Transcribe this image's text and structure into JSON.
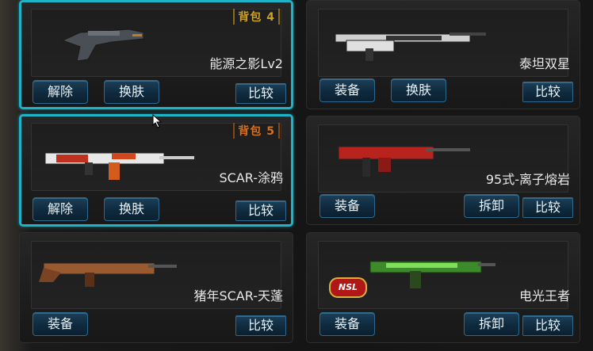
{
  "cards": [
    {
      "name": "能源之影Lv2",
      "bag": "背包 4",
      "selected": true,
      "buttons": [
        "解除",
        "换肤"
      ],
      "compare": "比较"
    },
    {
      "name": "泰坦双星",
      "selected": false,
      "buttons": [
        "装备",
        "换肤"
      ],
      "compare": "比较"
    },
    {
      "name": "SCAR-涂鸦",
      "bag": "背包 5",
      "selected": true,
      "buttons": [
        "解除",
        "换肤"
      ],
      "compare": "比较"
    },
    {
      "name": "95式-离子熔岩",
      "selected": false,
      "buttons": [
        "装备",
        "拆卸"
      ],
      "compare": "比较"
    },
    {
      "name": "猪年SCAR-天蓬",
      "selected": false,
      "buttons": [
        "装备"
      ],
      "compare": "比较"
    },
    {
      "name": "电光王者",
      "selected": false,
      "buttons": [
        "装备",
        "拆卸"
      ],
      "compare": "比较",
      "badge": "NSL"
    }
  ],
  "colors": {
    "selection": "#1fb3c8",
    "bag4": "#c9a227",
    "bag5": "#d5701f",
    "button": "#1c3f58"
  }
}
